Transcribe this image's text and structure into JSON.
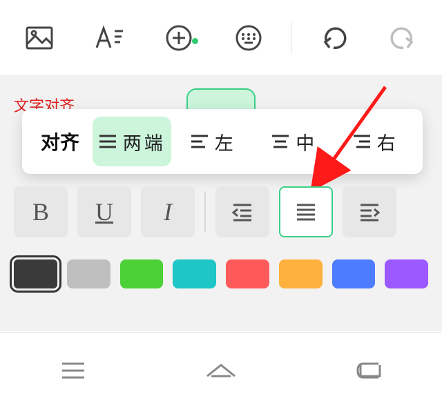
{
  "topbar": {
    "icons": [
      "image-icon",
      "text-format-icon",
      "add-icon",
      "keyboard-icon",
      "undo-icon",
      "redo-icon"
    ],
    "add_has_indicator": true
  },
  "annotation": {
    "text": "文字对齐"
  },
  "align_popup": {
    "label": "对齐",
    "options": [
      {
        "key": "justify",
        "text": "两端",
        "active": true
      },
      {
        "key": "left",
        "text": "左",
        "active": false
      },
      {
        "key": "center",
        "text": "中",
        "active": false
      },
      {
        "key": "right",
        "text": "右",
        "active": false
      }
    ]
  },
  "format_buttons": {
    "bold": "B",
    "underline": "U",
    "italic": "I",
    "indent_buttons": [
      "indent-decrease",
      "align-justify",
      "indent-increase"
    ],
    "selected": "align-justify"
  },
  "colors": {
    "swatches": [
      "#3a3a3a",
      "#bfbfbf",
      "#4cd137",
      "#1ec6c6",
      "#ff5a5a",
      "#ffb13d",
      "#4d7cff",
      "#9b59ff"
    ],
    "selected_index": 0
  },
  "bottom_nav": {
    "buttons": [
      "menu-icon",
      "home-icon",
      "back-icon"
    ]
  }
}
